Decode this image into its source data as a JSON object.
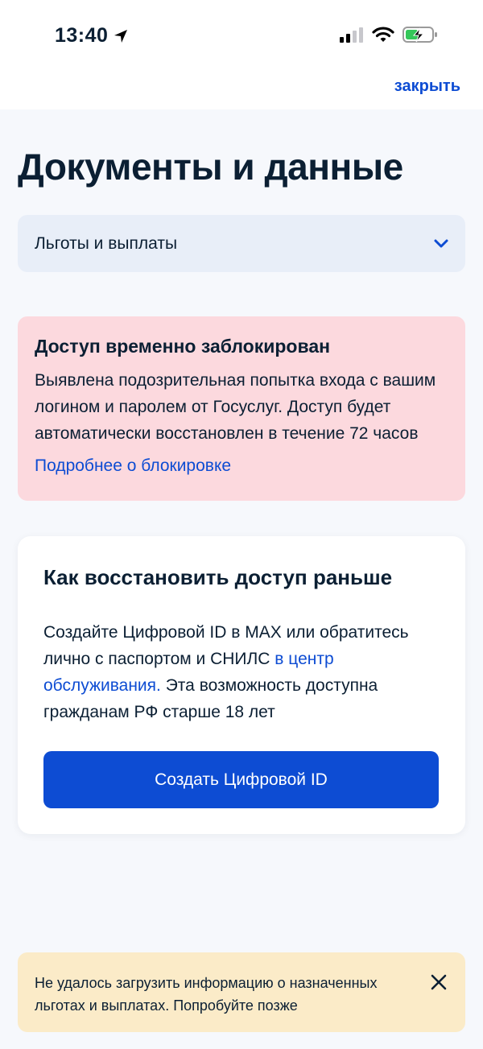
{
  "status_bar": {
    "time": "13:40",
    "icons": [
      "location-arrow-icon",
      "signal-icon",
      "wifi-icon",
      "battery-charging-icon"
    ]
  },
  "header": {
    "close_label": "закрыть"
  },
  "page": {
    "title": "Документы и данные"
  },
  "dropdown": {
    "selected": "Льготы и выплаты"
  },
  "alert": {
    "title": "Доступ временно заблокирован",
    "text": "Выявлена подозрительная попытка входа с вашим логином и паролем от Госуслуг. Доступ будет автоматически восстановлен в течение 72 часов",
    "link": "Подробнее о блокировке"
  },
  "restore_card": {
    "title": "Как восстановить доступ раньше",
    "text_before": "Создайте Цифровой ID в MAX или обратитесь лично с паспортом и СНИЛС ",
    "link": "в центр обслуживания.",
    "text_after": " Эта возможность доступна гражданам РФ старше 18 лет",
    "button_label": "Создать Цифровой ID"
  },
  "toast": {
    "text": "Не удалось загрузить информацию о назначенных льготах и выплатах. Попробуйте позже"
  },
  "colors": {
    "accent": "#0d4cd3",
    "alert_bg": "#fcd9de",
    "toast_bg": "#fbebc8",
    "dropdown_bg": "#e8eef8",
    "page_bg": "#f6f8fc"
  }
}
